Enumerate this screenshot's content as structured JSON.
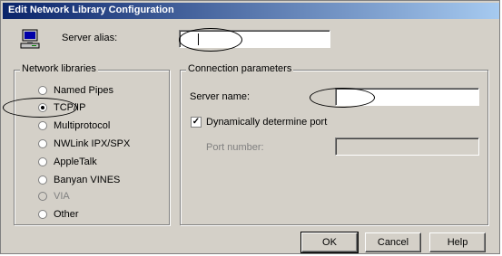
{
  "window": {
    "title": "Edit Network Library Configuration"
  },
  "server_alias": {
    "label": "Server alias:",
    "value": ""
  },
  "network_libraries": {
    "title": "Network libraries",
    "options": [
      {
        "label": "Named Pipes",
        "checked": false,
        "enabled": true
      },
      {
        "label": "TCP/IP",
        "checked": true,
        "enabled": true
      },
      {
        "label": "Multiprotocol",
        "checked": false,
        "enabled": true
      },
      {
        "label": "NWLink IPX/SPX",
        "checked": false,
        "enabled": true
      },
      {
        "label": "AppleTalk",
        "checked": false,
        "enabled": true
      },
      {
        "label": "Banyan VINES",
        "checked": false,
        "enabled": true
      },
      {
        "label": "VIA",
        "checked": false,
        "enabled": false
      },
      {
        "label": "Other",
        "checked": false,
        "enabled": true
      }
    ]
  },
  "connection": {
    "title": "Connection parameters",
    "server_name_label": "Server name:",
    "server_name_value": "",
    "dynamic_port_label": "Dynamically determine port",
    "dynamic_port_checked": true,
    "port_number_label": "Port number:",
    "port_number_value": ""
  },
  "buttons": {
    "ok": "OK",
    "cancel": "Cancel",
    "help": "Help"
  }
}
